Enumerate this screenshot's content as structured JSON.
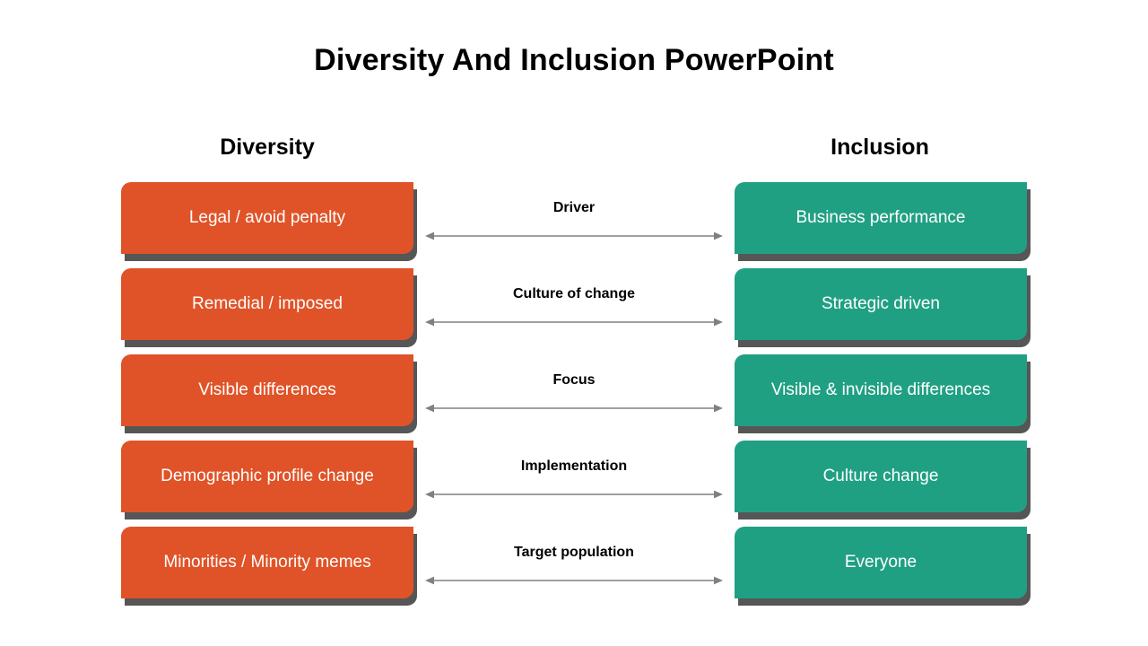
{
  "slide": {
    "title": "Diversity And Inclusion PowerPoint",
    "background_color": "#FFFFFF"
  },
  "columns": {
    "left_heading": "Diversity",
    "right_heading": "Inclusion"
  },
  "colors": {
    "left_box": "#E05328",
    "right_box": "#20A083",
    "box_shadow": "#565656",
    "arrow": "#808080",
    "text_on_box": "#FFFFFF",
    "heading_text": "#000000"
  },
  "icons": {
    "arrow": "double-headed-arrow-icon"
  },
  "rows": [
    {
      "left": "Legal / avoid penalty",
      "center": "Driver",
      "right": "Business performance"
    },
    {
      "left": "Remedial / imposed",
      "center": "Culture of change",
      "right": "Strategic driven"
    },
    {
      "left": "Visible differences",
      "center": "Focus",
      "right": "Visible & invisible differences"
    },
    {
      "left": "Demographic profile change",
      "center": "Implementation",
      "right": "Culture change"
    },
    {
      "left": "Minorities / Minority memes",
      "center": "Target population",
      "right": "Everyone"
    }
  ]
}
